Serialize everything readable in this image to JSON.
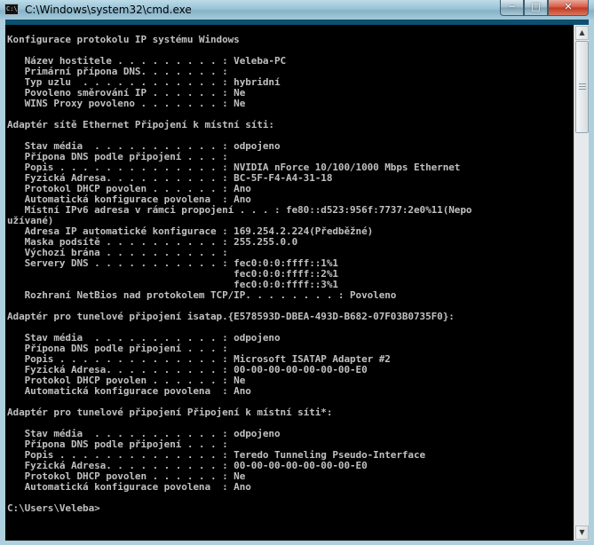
{
  "window": {
    "title": "C:\\Windows\\system32\\cmd.exe",
    "icon": "cmd-icon",
    "icon_text": "C:\\",
    "controls": {
      "minimize": "minimize-icon",
      "maximize": "maximize-icon",
      "close": "close-icon"
    }
  },
  "colors": {
    "console_bg": "#000000",
    "console_text": "#c0c0c0",
    "frame": "#aecfdd"
  },
  "console": {
    "lines": [
      "Konfigurace protokolu IP systému Windows",
      "",
      "   Název hostitele . . . . . . . . . : Veleba-PC",
      "   Primární přípona DNS. . . . . . . :",
      "   Typ uzlu  . . . . . . . . . . . . : hybridní",
      "   Povoleno směrování IP . . . . . . : Ne",
      "   WINS Proxy povoleno . . . . . . . : Ne",
      "",
      "Adaptér sítě Ethernet Připojení k místní síti:",
      "",
      "   Stav média  . . . . . . . . . . . : odpojeno",
      "   Přípona DNS podle připojení . . . :",
      "   Popis . . . . . . . . . . . . . . : NVIDIA nForce 10/100/1000 Mbps Ethernet",
      "   Fyzická Adresa. . . . . . . . . . : BC-5F-F4-A4-31-18",
      "   Protokol DHCP povolen . . . . . . : Ano",
      "   Automatická konfigurace povolena  : Ano",
      "   Místní IPv6 adresa v rámci propojení . . . : fe80::d523:956f:7737:2e0%11(Nepo",
      "užívané)",
      "   Adresa IP automatické konfigurace : 169.254.2.224(Předběžné)",
      "   Maska podsítě . . . . . . . . . . : 255.255.0.0",
      "   Výchozí brána . . . . . . . . . . :",
      "   Servery DNS . . . . . . . . . . . : fec0:0:0:ffff::1%1",
      "                                       fec0:0:0:ffff::2%1",
      "                                       fec0:0:0:ffff::3%1",
      "   Rozhraní NetBios nad protokolem TCP/IP. . . . . . . . : Povoleno",
      "",
      "Adaptér pro tunelové připojení isatap.{E578593D-DBEA-493D-B682-07F03B0735F0}:",
      "",
      "   Stav média  . . . . . . . . . . . : odpojeno",
      "   Přípona DNS podle připojení . . . :",
      "   Popis . . . . . . . . . . . . . . : Microsoft ISATAP Adapter #2",
      "   Fyzická Adresa. . . . . . . . . . : 00-00-00-00-00-00-00-E0",
      "   Protokol DHCP povolen . . . . . . : Ne",
      "   Automatická konfigurace povolena  : Ano",
      "",
      "Adaptér pro tunelové připojení Připojení k místní síti*:",
      "",
      "   Stav média  . . . . . . . . . . . : odpojeno",
      "   Přípona DNS podle připojení . . . :",
      "   Popis . . . . . . . . . . . . . . : Teredo Tunneling Pseudo-Interface",
      "   Fyzická Adresa. . . . . . . . . . : 00-00-00-00-00-00-00-E0",
      "   Protokol DHCP povolen . . . . . . : Ne",
      "   Automatická konfigurace povolena  : Ano",
      "",
      "C:\\Users\\Veleba>"
    ]
  },
  "scrollbar": {
    "up": "scroll-up-arrow-icon",
    "down": "scroll-down-arrow-icon",
    "up_glyph": "▲",
    "down_glyph": "▼"
  }
}
